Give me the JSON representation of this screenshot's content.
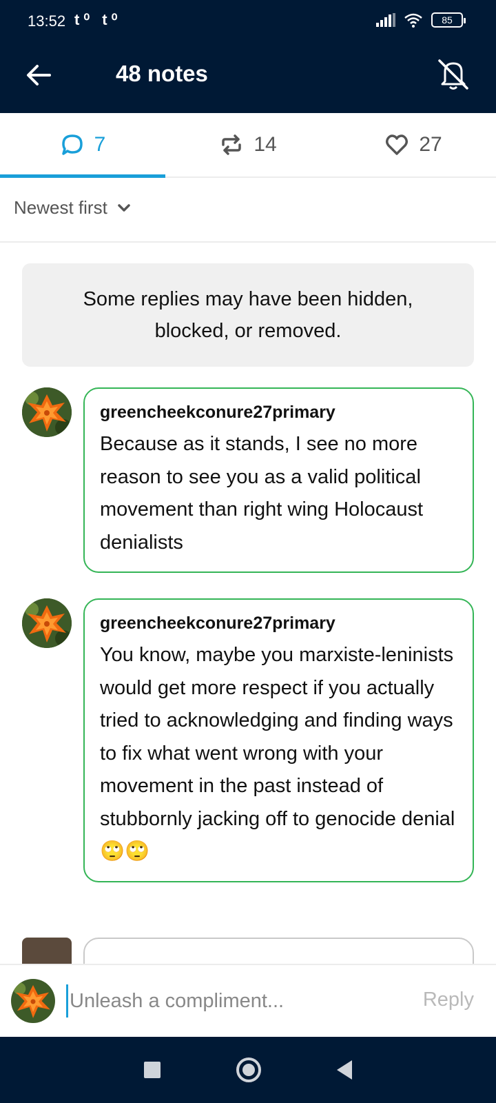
{
  "status_bar": {
    "time": "13:52",
    "app_icons": "t⁰ t⁰",
    "battery": "85"
  },
  "header": {
    "title": "48 notes"
  },
  "tabs": [
    {
      "icon": "reply-icon",
      "count": "7"
    },
    {
      "icon": "reblog-icon",
      "count": "14"
    },
    {
      "icon": "heart-icon",
      "count": "27"
    }
  ],
  "sort": {
    "label": "Newest first"
  },
  "notice": {
    "text": "Some replies may have been hidden, blocked, or removed."
  },
  "comments": [
    {
      "username": "greencheekconure27primary",
      "text": "Because as it stands, I see no more reason to see you as a valid political movement than right wing Holocaust denialists"
    },
    {
      "username": "greencheekconure27primary",
      "text": "You know, maybe you marxiste-leninists would get more respect if you actually tried to acknowledging and finding ways to fix what went wrong with your movement in the past instead of stubbornly jacking off to genocide denial 🙄🙄"
    }
  ],
  "reply_bar": {
    "placeholder": "Unleash a compliment...",
    "button": "Reply"
  },
  "colors": {
    "header_bg": "#001935",
    "accent": "#199fd9",
    "bubble_border": "#34b556"
  }
}
